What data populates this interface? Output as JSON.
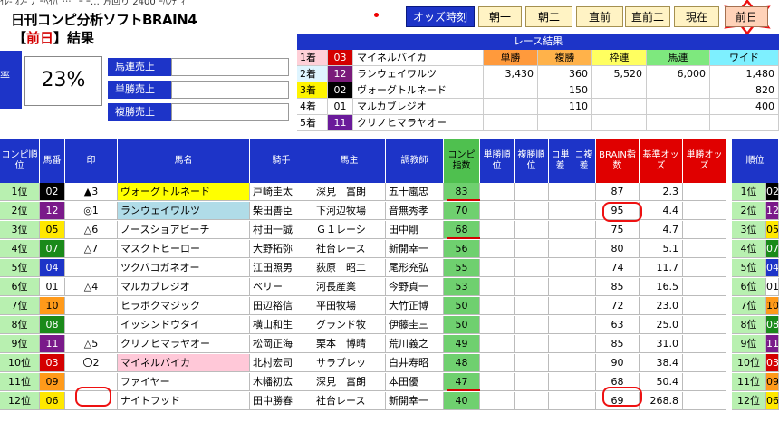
{
  "strip_text": "ｲﾚ‐ ｵﾝ‐ ﾌﾟｰﾍｲﾊﾞ…ﾞ ｰ ｰ… 方回り 2400 ｰﾊﾝﾃﾞｨ",
  "app": {
    "title": "日刊コンピ分析ソフトBRAIN4",
    "subtitle_open": "【",
    "subtitle_day": "前日",
    "subtitle_close": "】",
    "subtitle_result": "結果"
  },
  "toolbar": {
    "odds_label": "オッズ時刻",
    "buttons": [
      "朝一",
      "朝二",
      "直前",
      "直前二",
      "現在",
      "前日"
    ]
  },
  "stats": {
    "rate_label": "率",
    "rate_value": "23%",
    "labels": [
      "馬連売上",
      "単勝売上",
      "複勝売上"
    ]
  },
  "race_result": {
    "header": "レース結果",
    "col_labels": [
      "単勝",
      "複勝",
      "枠連",
      "馬連",
      "ワイド"
    ],
    "rows": [
      {
        "place": "1着",
        "num": "03",
        "name": "マイネルバイカ",
        "tansho": "",
        "fukusho": "",
        "wakuren": "",
        "umaren": "",
        "wide": ""
      },
      {
        "place": "2着",
        "num": "12",
        "name": "ランウェイワルツ",
        "tansho": "3,430",
        "fukusho": "360",
        "wakuren": "5,520",
        "umaren": "6,000",
        "wide": "1,480"
      },
      {
        "place": "3着",
        "num": "02",
        "name": "ヴォーグトルネード",
        "tansho": "",
        "fukusho": "150",
        "wakuren": "",
        "umaren": "",
        "wide": "820"
      },
      {
        "place": "4着",
        "num": "01",
        "name": "マルカブレジオ",
        "tansho": "",
        "fukusho": "110",
        "wakuren": "",
        "umaren": "",
        "wide": "400"
      },
      {
        "place": "5着",
        "num": "11",
        "name": "クリノヒマラヤオー",
        "tansho": "",
        "fukusho": "",
        "wakuren": "",
        "umaren": "",
        "wide": ""
      }
    ]
  },
  "grid": {
    "headers": [
      "コンピ順位",
      "馬番",
      "印",
      "馬名",
      "騎手",
      "馬主",
      "調教師",
      "コンピ指数",
      "単勝順位",
      "複勝順位",
      "コ単差",
      "コ複差",
      "BRAIN指数",
      "基準オッズ",
      "単勝オッズ",
      "順位"
    ],
    "rows": [
      {
        "rank": "1位",
        "num": "02",
        "mark": "▲3",
        "horse": "ヴォーグトルネード",
        "jockey": "戸崎圭太",
        "owner": "深見　富朗",
        "trainer": "五十嵐忠",
        "compi": "83",
        "brain": "87",
        "base": "2.3",
        "rrank": "1位"
      },
      {
        "rank": "2位",
        "num": "12",
        "mark": "◎1",
        "horse": "ランウェイワルツ",
        "jockey": "柴田善臣",
        "owner": "下河辺牧場",
        "trainer": "音無秀孝",
        "compi": "70",
        "brain": "95",
        "base": "4.4",
        "rrank": "2位"
      },
      {
        "rank": "3位",
        "num": "05",
        "mark": "△6",
        "horse": "ノースショアビーチ",
        "jockey": "村田一誠",
        "owner": "Ｇ１レーシ",
        "trainer": "田中剛",
        "compi": "68",
        "brain": "75",
        "base": "4.7",
        "rrank": "3位"
      },
      {
        "rank": "4位",
        "num": "07",
        "mark": "△7",
        "horse": "マスクトヒーロー",
        "jockey": "大野拓弥",
        "owner": "社台レース",
        "trainer": "新開幸一",
        "compi": "56",
        "brain": "80",
        "base": "5.1",
        "rrank": "4位"
      },
      {
        "rank": "5位",
        "num": "04",
        "mark": "",
        "horse": "ツクバコガネオー",
        "jockey": "江田照男",
        "owner": "荻原　昭二",
        "trainer": "尾形充弘",
        "compi": "55",
        "brain": "74",
        "base": "11.7",
        "rrank": "5位"
      },
      {
        "rank": "6位",
        "num": "01",
        "mark": "△4",
        "horse": "マルカブレジオ",
        "jockey": "ベリー",
        "owner": "河長産業",
        "trainer": "今野貞一",
        "compi": "53",
        "brain": "85",
        "base": "16.5",
        "rrank": "6位"
      },
      {
        "rank": "7位",
        "num": "10",
        "mark": "",
        "horse": "ヒラボクマジック",
        "jockey": "田辺裕信",
        "owner": "平田牧場",
        "trainer": "大竹正博",
        "compi": "50",
        "brain": "72",
        "base": "23.0",
        "rrank": "7位"
      },
      {
        "rank": "8位",
        "num": "08",
        "mark": "",
        "horse": "イッシンドウタイ",
        "jockey": "横山和生",
        "owner": "グランド牧",
        "trainer": "伊藤圭三",
        "compi": "50",
        "brain": "63",
        "base": "25.0",
        "rrank": "8位"
      },
      {
        "rank": "9位",
        "num": "11",
        "mark": "△5",
        "horse": "クリノヒマラヤオー",
        "jockey": "松岡正海",
        "owner": "栗本　博晴",
        "trainer": "荒川義之",
        "compi": "49",
        "brain": "85",
        "base": "31.0",
        "rrank": "9位"
      },
      {
        "rank": "10位",
        "num": "03",
        "mark": "〇2",
        "horse": "マイネルバイカ",
        "jockey": "北村宏司",
        "owner": "サラブレッ",
        "trainer": "白井寿昭",
        "compi": "48",
        "brain": "90",
        "base": "38.4",
        "rrank": "10位"
      },
      {
        "rank": "11位",
        "num": "09",
        "mark": "",
        "horse": "ファイヤー",
        "jockey": "木幡初広",
        "owner": "深見　富朗",
        "trainer": "本田優",
        "compi": "47",
        "brain": "68",
        "base": "50.4",
        "rrank": "11位"
      },
      {
        "rank": "12位",
        "num": "06",
        "mark": "",
        "horse": "ナイトフッド",
        "jockey": "田中勝春",
        "owner": "社台レース",
        "trainer": "新開幸一",
        "compi": "40",
        "brain": "69",
        "base": "268.8",
        "rrank": "12位"
      }
    ]
  },
  "colors": {
    "header_blue": "#1d34c8",
    "compi_green": "#4fc04f",
    "brain_red": "#e00000"
  }
}
